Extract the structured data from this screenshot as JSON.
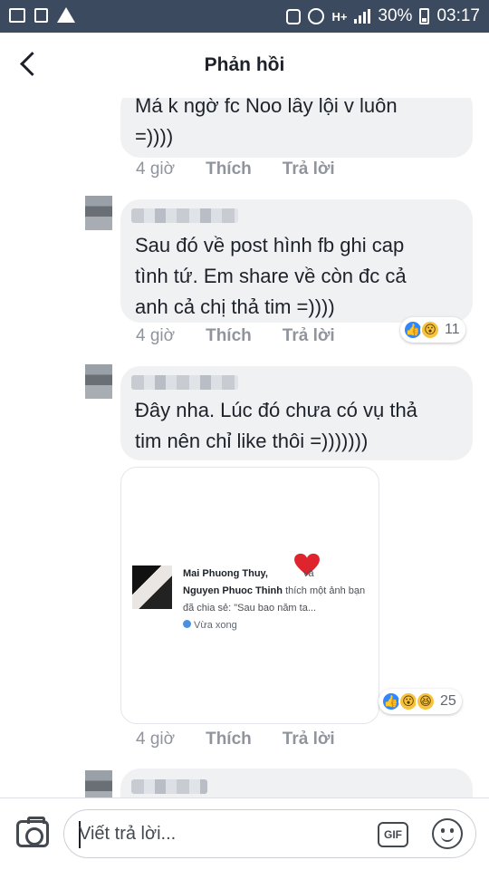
{
  "status_bar": {
    "battery": "30%",
    "time": "03:17",
    "network": "H+",
    "left_icons": [
      "gallery-icon",
      "file-icon",
      "warning-icon"
    ],
    "right_icons": [
      "screenshot-icon",
      "alarm-icon",
      "signal-icon",
      "battery-icon"
    ]
  },
  "header": {
    "title": "Phản hồi",
    "back_icon": "back-arrow-icon"
  },
  "comments": [
    {
      "text": "Má k ngờ fc Noo lầy lội v luôn\n=))))",
      "time": "4 giờ",
      "like": "Thích",
      "reply": "Trả lời"
    },
    {
      "text": "Sau đó về post hình fb ghi cap\ntình tứ. Em share về còn đc cả\nanh cả chị thả tim =))))",
      "time": "4 giờ",
      "like": "Thích",
      "reply": "Trả lời",
      "reaction_count": "11",
      "reactions": [
        "like",
        "wow"
      ]
    },
    {
      "text": "Đây nha. Lúc đó chưa có vụ thả\ntim nên chỉ like thôi =)))))))",
      "time": "4 giờ",
      "like": "Thích",
      "reply": "Trả lời",
      "reaction_count": "25",
      "reactions": [
        "like",
        "wow",
        "haha"
      ]
    }
  ],
  "shared_image": {
    "name1": "Mai Phuong Thuy,",
    "conj": "và",
    "name2": "Nguyen Phuoc Thinh",
    "rest": "thích một ảnh bạn đã chia sẻ: \"Sau bao năm ta...",
    "time": "Vừa xong"
  },
  "composer": {
    "placeholder": "Viết trả lời...",
    "gif_label": "GIF"
  },
  "colors": {
    "status_bar": "#3b4a5e",
    "bubble": "#f0f1f3",
    "meta": "#90949c",
    "like_blue": "#2d88ff",
    "heart_red": "#e0242e"
  }
}
